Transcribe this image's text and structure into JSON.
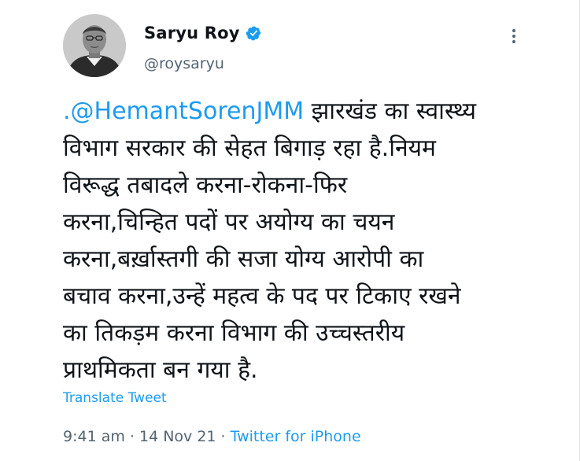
{
  "author": {
    "display_name": "Saryu Roy",
    "handle": "@roysaryu",
    "verified": true
  },
  "tweet": {
    "mention": ".@HemantSorenJMM",
    "lines": [
      " झारखंड का स्वास्थ्य",
      "विभाग सरकार की सेहत बिगाड़ रहा है.नियम",
      "विरूद्ध तबादले करना-रोकना-फिर",
      "करना,चिन्हित पदों पर अयोग्य का चयन",
      "करना,बर्ख़ास्तगी की सजा योग्य आरोपी का",
      "बचाव करना,उन्हें महत्व के पद पर टिकाए रखने",
      "का तिकड़म करना विभाग की उच्चस्तरीय",
      "प्राथमिकता बन गया है."
    ]
  },
  "translate_label": "Translate Tweet",
  "meta": {
    "time": "9:41 am",
    "separator": " · ",
    "date": "14 Nov 21",
    "source": "Twitter for iPhone"
  },
  "icons": {
    "verified": "verified-badge-icon",
    "more": "more-options-icon"
  },
  "colors": {
    "link": "#1d9bf0",
    "text": "#0f1419",
    "secondary": "#536471"
  }
}
